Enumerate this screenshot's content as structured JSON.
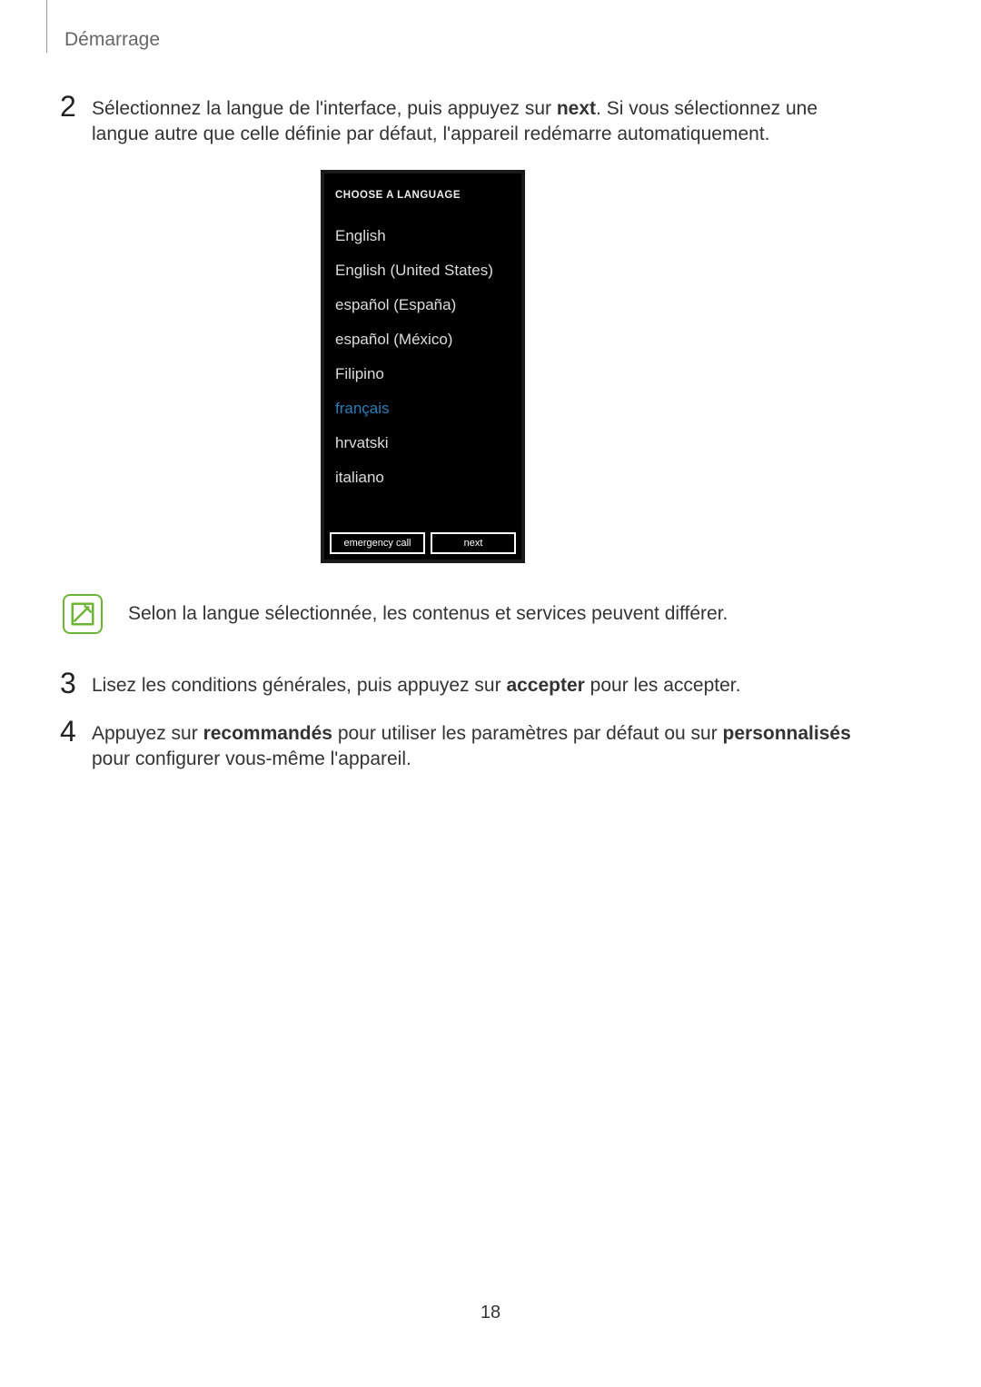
{
  "section_title": "Démarrage",
  "step2": {
    "num": "2",
    "pre": "Sélectionnez la langue de l'interface, puis appuyez sur ",
    "bold1": "next",
    "post": ". Si vous sélectionnez une langue autre que celle définie par défaut, l'appareil redémarre automatiquement."
  },
  "phone": {
    "header": "CHOOSE A LANGUAGE",
    "languages": [
      {
        "label": "English",
        "selected": false
      },
      {
        "label": "English (United States)",
        "selected": false
      },
      {
        "label": "español (España)",
        "selected": false
      },
      {
        "label": "español (México)",
        "selected": false
      },
      {
        "label": "Filipino",
        "selected": false
      },
      {
        "label": "français",
        "selected": true
      },
      {
        "label": "hrvatski",
        "selected": false
      },
      {
        "label": "italiano",
        "selected": false
      }
    ],
    "btn_emergency": "emergency call",
    "btn_next": "next"
  },
  "info_text": "Selon la langue sélectionnée, les contenus et services peuvent différer.",
  "step3": {
    "num": "3",
    "pre": "Lisez les conditions générales, puis appuyez sur ",
    "bold1": "accepter",
    "post": " pour les accepter."
  },
  "step4": {
    "num": "4",
    "pre": "Appuyez sur ",
    "bold1": "recommandés",
    "mid": " pour utiliser les paramètres par défaut ou sur ",
    "bold2": "personnalisés",
    "post": " pour configurer vous-même l'appareil."
  },
  "page_number": "18"
}
